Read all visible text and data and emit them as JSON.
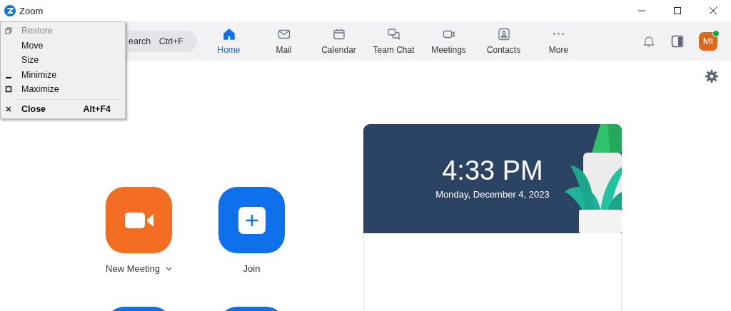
{
  "window": {
    "title": "Zoom"
  },
  "system_menu": [
    {
      "label": "Restore",
      "kind": "restore",
      "disabled": true,
      "default": false
    },
    {
      "label": "Move",
      "kind": "plain",
      "disabled": false,
      "default": false
    },
    {
      "label": "Size",
      "kind": "plain",
      "disabled": false,
      "default": false
    },
    {
      "label": "Minimize",
      "kind": "minimize",
      "disabled": false,
      "default": false
    },
    {
      "label": "Maximize",
      "kind": "maximize",
      "disabled": false,
      "default": false
    },
    {
      "label": "Close",
      "kind": "close",
      "disabled": false,
      "default": true,
      "shortcut": "Alt+F4"
    }
  ],
  "search": {
    "label": "earch",
    "shortcut": "Ctrl+F"
  },
  "tabs": [
    {
      "label": "Home",
      "kind": "home",
      "selected": true
    },
    {
      "label": "Mail",
      "kind": "mail",
      "selected": false
    },
    {
      "label": "Calendar",
      "kind": "calendar",
      "selected": false
    },
    {
      "label": "Team Chat",
      "kind": "chat",
      "selected": false
    },
    {
      "label": "Meetings",
      "kind": "meetings",
      "selected": false
    },
    {
      "label": "Contacts",
      "kind": "contacts",
      "selected": false
    },
    {
      "label": "More",
      "kind": "more",
      "selected": false
    }
  ],
  "avatar": {
    "initials": "MI",
    "online": true
  },
  "tiles": [
    {
      "label": "New Meeting",
      "kind": "video",
      "color": "#f26d21",
      "dropdown": true
    },
    {
      "label": "Join",
      "kind": "plus",
      "color": "#0e71eb",
      "dropdown": false
    },
    {
      "kind": "partial",
      "color": "#0e71eb"
    },
    {
      "kind": "partial",
      "color": "#0e71eb"
    }
  ],
  "clock": {
    "time": "4:33 PM",
    "date": "Monday, December 4, 2023"
  }
}
